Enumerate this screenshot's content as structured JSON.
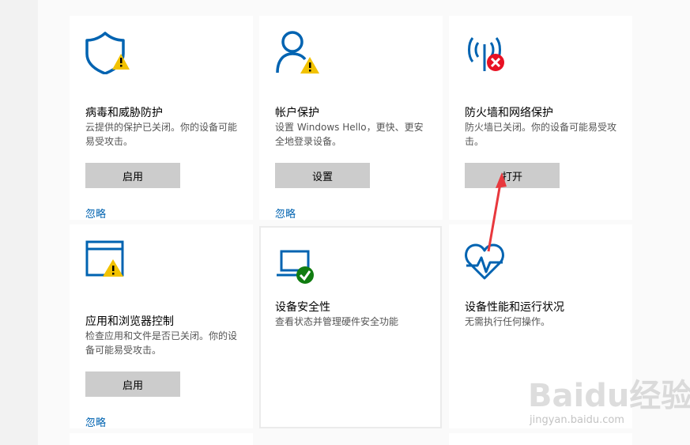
{
  "tiles": [
    {
      "id": "virus",
      "title": "病毒和威胁防护",
      "desc": "云提供的保护已关闭。你的设备可能易受攻击。",
      "button": "启用",
      "link": "忽略",
      "icon": "shield-warning-icon"
    },
    {
      "id": "account",
      "title": "帐户保护",
      "desc": "设置 Windows Hello，更快、更安全地登录设备。",
      "button": "设置",
      "link": "忽略",
      "icon": "person-warning-icon"
    },
    {
      "id": "firewall",
      "title": "防火墙和网络保护",
      "desc": "防火墙已关闭。你的设备可能易受攻击。",
      "button": "打开",
      "icon": "antenna-error-icon"
    },
    {
      "id": "appbrowser",
      "title": "应用和浏览器控制",
      "desc": "检查应用和文件是否已关闭。你的设备可能易受攻击。",
      "button": "启用",
      "link": "忽略",
      "icon": "window-warning-icon"
    },
    {
      "id": "devicesecurity",
      "title": "设备安全性",
      "desc": "查看状态并管理硬件安全功能",
      "icon": "laptop-check-icon"
    },
    {
      "id": "performance",
      "title": "设备性能和运行状况",
      "desc": "无需执行任何操作。",
      "icon": "heart-pulse-icon"
    }
  ],
  "watermark": {
    "brand": "Baidu经验",
    "url": "jingyan.baidu.com"
  },
  "colors": {
    "accent_blue": "#0063b1",
    "warning_yellow": "#f2c200",
    "error_red": "#e81123",
    "ok_green": "#107c10",
    "button_gray": "#cccccc"
  }
}
